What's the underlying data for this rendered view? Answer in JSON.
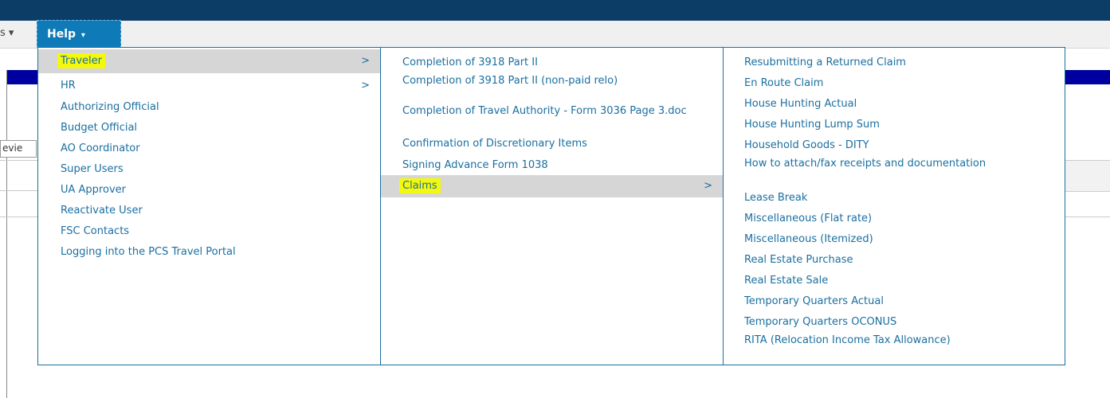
{
  "menubar": {
    "prev_menu_label": "s ▾",
    "help_label": "Help",
    "help_caret": "▾"
  },
  "background": {
    "field_text": "evie"
  },
  "menu": {
    "chevron": ">",
    "col1": [
      {
        "label": "Traveler",
        "has_submenu": true,
        "active": true,
        "highlighted": true
      },
      {
        "label": "HR",
        "has_submenu": true
      },
      {
        "label": "Authorizing Official"
      },
      {
        "label": "Budget Official"
      },
      {
        "label": "AO Coordinator"
      },
      {
        "label": "Super Users"
      },
      {
        "label": "UA Approver"
      },
      {
        "label": "Reactivate User"
      },
      {
        "label": "FSC Contacts"
      },
      {
        "label": "Logging into the PCS Travel Portal"
      }
    ],
    "col2": [
      {
        "label": "Completion of 3918 Part II"
      },
      {
        "label": "Completion of 3918 Part II (non-paid relo)"
      },
      {
        "label": "Completion of Travel Authority - Form 3036 Page 3.doc"
      },
      {
        "label": "Confirmation of Discretionary Items"
      },
      {
        "label": "Signing Advance Form 1038"
      },
      {
        "label": "Claims",
        "has_submenu": true,
        "active": true,
        "highlighted": true
      }
    ],
    "col3": [
      {
        "label": "Resubmitting a Returned Claim"
      },
      {
        "label": "En Route Claim"
      },
      {
        "label": "House Hunting Actual"
      },
      {
        "label": "House Hunting Lump Sum"
      },
      {
        "label": "Household Goods - DITY"
      },
      {
        "label": "How to attach/fax receipts and documentation"
      },
      {
        "label": "Lease Break"
      },
      {
        "label": "Miscellaneous (Flat rate)"
      },
      {
        "label": "Miscellaneous (Itemized)"
      },
      {
        "label": "Real Estate Purchase"
      },
      {
        "label": "Real Estate Sale"
      },
      {
        "label": "Temporary Quarters Actual"
      },
      {
        "label": "Temporary Quarters OCONUS"
      },
      {
        "label": "RITA (Relocation Income Tax Allowance)"
      }
    ]
  },
  "colors": {
    "link": "#1a6fa0",
    "highlight": "#f4f80d",
    "active_bg": "#d6d6d6",
    "nav_dark": "#0b3d66",
    "help_bg": "#0f7ab8"
  }
}
